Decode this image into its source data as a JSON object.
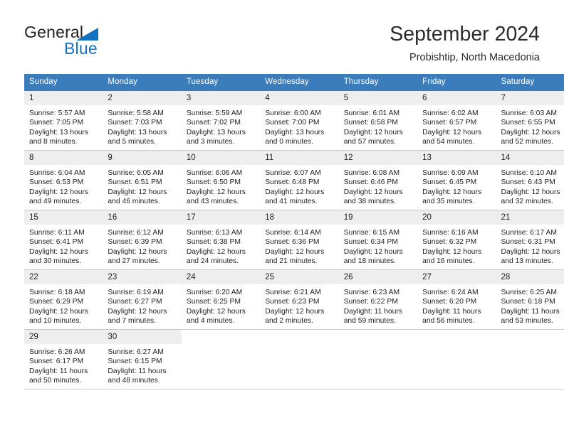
{
  "brand": {
    "name_part1": "General",
    "name_part2": "Blue",
    "triangle_color": "#1271c0"
  },
  "header": {
    "title": "September 2024",
    "subtitle": "Probishtip, North Macedonia"
  },
  "theme": {
    "header_blue": "#3b7cba",
    "daynum_band": "#eeeeee",
    "row_separator": "#c8c8c8",
    "text": "#222222"
  },
  "weekday_headers": [
    "Sunday",
    "Monday",
    "Tuesday",
    "Wednesday",
    "Thursday",
    "Friday",
    "Saturday"
  ],
  "weeks": [
    [
      {
        "day": "1",
        "sunrise": "Sunrise: 5:57 AM",
        "sunset": "Sunset: 7:05 PM",
        "daylight_line1": "Daylight: 13 hours",
        "daylight_line2": "and 8 minutes."
      },
      {
        "day": "2",
        "sunrise": "Sunrise: 5:58 AM",
        "sunset": "Sunset: 7:03 PM",
        "daylight_line1": "Daylight: 13 hours",
        "daylight_line2": "and 5 minutes."
      },
      {
        "day": "3",
        "sunrise": "Sunrise: 5:59 AM",
        "sunset": "Sunset: 7:02 PM",
        "daylight_line1": "Daylight: 13 hours",
        "daylight_line2": "and 3 minutes."
      },
      {
        "day": "4",
        "sunrise": "Sunrise: 6:00 AM",
        "sunset": "Sunset: 7:00 PM",
        "daylight_line1": "Daylight: 13 hours",
        "daylight_line2": "and 0 minutes."
      },
      {
        "day": "5",
        "sunrise": "Sunrise: 6:01 AM",
        "sunset": "Sunset: 6:58 PM",
        "daylight_line1": "Daylight: 12 hours",
        "daylight_line2": "and 57 minutes."
      },
      {
        "day": "6",
        "sunrise": "Sunrise: 6:02 AM",
        "sunset": "Sunset: 6:57 PM",
        "daylight_line1": "Daylight: 12 hours",
        "daylight_line2": "and 54 minutes."
      },
      {
        "day": "7",
        "sunrise": "Sunrise: 6:03 AM",
        "sunset": "Sunset: 6:55 PM",
        "daylight_line1": "Daylight: 12 hours",
        "daylight_line2": "and 52 minutes."
      }
    ],
    [
      {
        "day": "8",
        "sunrise": "Sunrise: 6:04 AM",
        "sunset": "Sunset: 6:53 PM",
        "daylight_line1": "Daylight: 12 hours",
        "daylight_line2": "and 49 minutes."
      },
      {
        "day": "9",
        "sunrise": "Sunrise: 6:05 AM",
        "sunset": "Sunset: 6:51 PM",
        "daylight_line1": "Daylight: 12 hours",
        "daylight_line2": "and 46 minutes."
      },
      {
        "day": "10",
        "sunrise": "Sunrise: 6:06 AM",
        "sunset": "Sunset: 6:50 PM",
        "daylight_line1": "Daylight: 12 hours",
        "daylight_line2": "and 43 minutes."
      },
      {
        "day": "11",
        "sunrise": "Sunrise: 6:07 AM",
        "sunset": "Sunset: 6:48 PM",
        "daylight_line1": "Daylight: 12 hours",
        "daylight_line2": "and 41 minutes."
      },
      {
        "day": "12",
        "sunrise": "Sunrise: 6:08 AM",
        "sunset": "Sunset: 6:46 PM",
        "daylight_line1": "Daylight: 12 hours",
        "daylight_line2": "and 38 minutes."
      },
      {
        "day": "13",
        "sunrise": "Sunrise: 6:09 AM",
        "sunset": "Sunset: 6:45 PM",
        "daylight_line1": "Daylight: 12 hours",
        "daylight_line2": "and 35 minutes."
      },
      {
        "day": "14",
        "sunrise": "Sunrise: 6:10 AM",
        "sunset": "Sunset: 6:43 PM",
        "daylight_line1": "Daylight: 12 hours",
        "daylight_line2": "and 32 minutes."
      }
    ],
    [
      {
        "day": "15",
        "sunrise": "Sunrise: 6:11 AM",
        "sunset": "Sunset: 6:41 PM",
        "daylight_line1": "Daylight: 12 hours",
        "daylight_line2": "and 30 minutes."
      },
      {
        "day": "16",
        "sunrise": "Sunrise: 6:12 AM",
        "sunset": "Sunset: 6:39 PM",
        "daylight_line1": "Daylight: 12 hours",
        "daylight_line2": "and 27 minutes."
      },
      {
        "day": "17",
        "sunrise": "Sunrise: 6:13 AM",
        "sunset": "Sunset: 6:38 PM",
        "daylight_line1": "Daylight: 12 hours",
        "daylight_line2": "and 24 minutes."
      },
      {
        "day": "18",
        "sunrise": "Sunrise: 6:14 AM",
        "sunset": "Sunset: 6:36 PM",
        "daylight_line1": "Daylight: 12 hours",
        "daylight_line2": "and 21 minutes."
      },
      {
        "day": "19",
        "sunrise": "Sunrise: 6:15 AM",
        "sunset": "Sunset: 6:34 PM",
        "daylight_line1": "Daylight: 12 hours",
        "daylight_line2": "and 18 minutes."
      },
      {
        "day": "20",
        "sunrise": "Sunrise: 6:16 AM",
        "sunset": "Sunset: 6:32 PM",
        "daylight_line1": "Daylight: 12 hours",
        "daylight_line2": "and 16 minutes."
      },
      {
        "day": "21",
        "sunrise": "Sunrise: 6:17 AM",
        "sunset": "Sunset: 6:31 PM",
        "daylight_line1": "Daylight: 12 hours",
        "daylight_line2": "and 13 minutes."
      }
    ],
    [
      {
        "day": "22",
        "sunrise": "Sunrise: 6:18 AM",
        "sunset": "Sunset: 6:29 PM",
        "daylight_line1": "Daylight: 12 hours",
        "daylight_line2": "and 10 minutes."
      },
      {
        "day": "23",
        "sunrise": "Sunrise: 6:19 AM",
        "sunset": "Sunset: 6:27 PM",
        "daylight_line1": "Daylight: 12 hours",
        "daylight_line2": "and 7 minutes."
      },
      {
        "day": "24",
        "sunrise": "Sunrise: 6:20 AM",
        "sunset": "Sunset: 6:25 PM",
        "daylight_line1": "Daylight: 12 hours",
        "daylight_line2": "and 4 minutes."
      },
      {
        "day": "25",
        "sunrise": "Sunrise: 6:21 AM",
        "sunset": "Sunset: 6:23 PM",
        "daylight_line1": "Daylight: 12 hours",
        "daylight_line2": "and 2 minutes."
      },
      {
        "day": "26",
        "sunrise": "Sunrise: 6:23 AM",
        "sunset": "Sunset: 6:22 PM",
        "daylight_line1": "Daylight: 11 hours",
        "daylight_line2": "and 59 minutes."
      },
      {
        "day": "27",
        "sunrise": "Sunrise: 6:24 AM",
        "sunset": "Sunset: 6:20 PM",
        "daylight_line1": "Daylight: 11 hours",
        "daylight_line2": "and 56 minutes."
      },
      {
        "day": "28",
        "sunrise": "Sunrise: 6:25 AM",
        "sunset": "Sunset: 6:18 PM",
        "daylight_line1": "Daylight: 11 hours",
        "daylight_line2": "and 53 minutes."
      }
    ],
    [
      {
        "day": "29",
        "sunrise": "Sunrise: 6:26 AM",
        "sunset": "Sunset: 6:17 PM",
        "daylight_line1": "Daylight: 11 hours",
        "daylight_line2": "and 50 minutes."
      },
      {
        "day": "30",
        "sunrise": "Sunrise: 6:27 AM",
        "sunset": "Sunset: 6:15 PM",
        "daylight_line1": "Daylight: 11 hours",
        "daylight_line2": "and 48 minutes."
      },
      {
        "day": "",
        "sunrise": "",
        "sunset": "",
        "daylight_line1": "",
        "daylight_line2": ""
      },
      {
        "day": "",
        "sunrise": "",
        "sunset": "",
        "daylight_line1": "",
        "daylight_line2": ""
      },
      {
        "day": "",
        "sunrise": "",
        "sunset": "",
        "daylight_line1": "",
        "daylight_line2": ""
      },
      {
        "day": "",
        "sunrise": "",
        "sunset": "",
        "daylight_line1": "",
        "daylight_line2": ""
      },
      {
        "day": "",
        "sunrise": "",
        "sunset": "",
        "daylight_line1": "",
        "daylight_line2": ""
      }
    ]
  ]
}
